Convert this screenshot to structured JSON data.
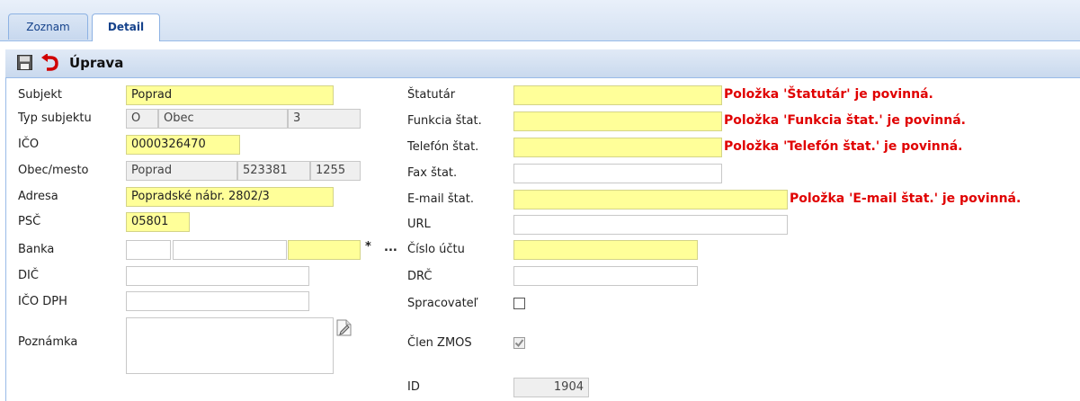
{
  "tabs": [
    {
      "label": "Zoznam"
    },
    {
      "label": "Detail"
    }
  ],
  "header": {
    "title": "Úprava",
    "save_icon": "save-icon",
    "undo_icon": "undo-icon"
  },
  "left": {
    "subjekt": {
      "label": "Subjekt",
      "value": "Poprad"
    },
    "typ": {
      "label": "Typ subjektu",
      "code": "O",
      "name": "Obec",
      "num": "3"
    },
    "ico": {
      "label": "IČO",
      "value": "0000326470"
    },
    "obec": {
      "label": "Obec/mesto",
      "name": "Poprad",
      "code1": "523381",
      "code2": "1255"
    },
    "adresa": {
      "label": "Adresa",
      "value": "Popradské nábr. 2802/3"
    },
    "psc": {
      "label": "PSČ",
      "value": "05801"
    },
    "banka": {
      "label": "Banka",
      "f1": "",
      "f2": "",
      "f3": "",
      "star": "*",
      "dots": "..."
    },
    "dic": {
      "label": "DIČ",
      "value": ""
    },
    "icodph": {
      "label": "IČO DPH",
      "value": ""
    },
    "poznamka": {
      "label": "Poznámka",
      "value": ""
    }
  },
  "right": {
    "statutar": {
      "label": "Štatutár",
      "value": "",
      "error": "Položka 'Štatutár' je povinná."
    },
    "funkcia": {
      "label": "Funkcia štat.",
      "value": "",
      "error": "Položka 'Funkcia štat.' je povinná."
    },
    "telefon": {
      "label": "Telefón štat.",
      "value": "",
      "error": "Položka 'Telefón štat.' je povinná."
    },
    "fax": {
      "label": "Fax štat.",
      "value": ""
    },
    "email": {
      "label": "E-mail štat.",
      "value": "",
      "error": "Položka 'E-mail štat.' je povinná."
    },
    "url": {
      "label": "URL",
      "value": ""
    },
    "ucet": {
      "label": "Číslo účtu",
      "value": ""
    },
    "drc": {
      "label": "DRČ",
      "value": ""
    },
    "spracovatel": {
      "label": "Spracovateľ",
      "checked": false
    },
    "clen": {
      "label": "Člen ZMOS",
      "checked": true
    },
    "id": {
      "label": "ID",
      "value": "1904"
    }
  },
  "colors": {
    "required": "#ffff99",
    "error": "#e00000",
    "accent": "#15428b"
  }
}
